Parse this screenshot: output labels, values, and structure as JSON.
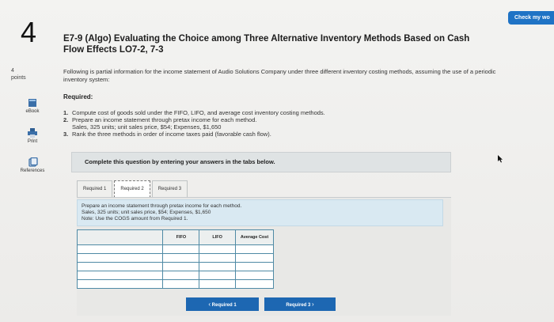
{
  "question": {
    "number": "4",
    "points_value": "4",
    "points_label": "points",
    "title": "E7-9 (Algo) Evaluating the Choice among Three Alternative Inventory Methods Based on Cash Flow Effects LO7-2, 7-3",
    "intro": "Following is partial information for the income statement of Audio Solutions Company under three different inventory costing methods, assuming the use of a periodic inventory system:",
    "required_heading": "Required:",
    "requirements": [
      {
        "num": "1.",
        "text": "Compute cost of goods sold under the FIFO, LIFO, and average cost inventory costing methods."
      },
      {
        "num": "2.",
        "text": "Prepare an income statement through pretax income for each method.",
        "sub": "Sales, 325 units; unit sales price, $54; Expenses, $1,650"
      },
      {
        "num": "3.",
        "text": "Rank the three methods in order of income taxes paid (favorable cash flow)."
      }
    ]
  },
  "header": {
    "check_button": "Check my wo"
  },
  "sidebar": {
    "ebook": "eBook",
    "print": "Print",
    "references": "References"
  },
  "panel": {
    "instruction": "Complete this question by entering your answers in the tabs below."
  },
  "tabs": [
    {
      "label": "Required 1"
    },
    {
      "label": "Required 2"
    },
    {
      "label": "Required 3"
    }
  ],
  "active_tab": "Required 2",
  "content": {
    "line1": "Prepare an income statement through pretax income for each method.",
    "line2": "Sales, 325 units; unit sales price, $54; Expenses, $1,650",
    "line3": "Note: Use the COGS amount from Required 1."
  },
  "table": {
    "headers": [
      "",
      "FIFO",
      "LIFO",
      "Average Cost"
    ],
    "rows": [
      [
        "",
        "",
        "",
        ""
      ],
      [
        "",
        "",
        "",
        ""
      ],
      [
        "",
        "",
        "",
        ""
      ],
      [
        "",
        "",
        "",
        ""
      ],
      [
        "",
        "",
        "",
        ""
      ]
    ]
  },
  "nav": {
    "prev_label": "Required 1",
    "next_label": "Required 3"
  },
  "colors": {
    "accent": "#1d67b2",
    "grid_border": "#4f8aa5",
    "instruction_bg": "#d9e9f2"
  }
}
